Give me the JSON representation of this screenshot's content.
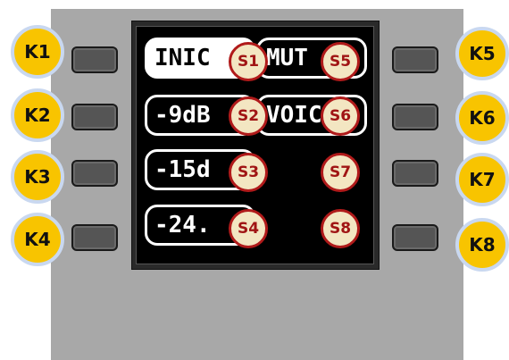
{
  "keys_left": [
    "K1",
    "K2",
    "K3",
    "K4"
  ],
  "keys_right": [
    "K5",
    "K6",
    "K7",
    "K8"
  ],
  "softkeys": {
    "s1_text": "INIC",
    "s2_text": "-9dB",
    "s3_text": "-15d",
    "s4_text": "-24.",
    "s5_text": "MUT",
    "s6_text": "VOIC"
  },
  "screen_badges": [
    "S1",
    "S2",
    "S3",
    "S4",
    "S5",
    "S6",
    "S7",
    "S8"
  ]
}
